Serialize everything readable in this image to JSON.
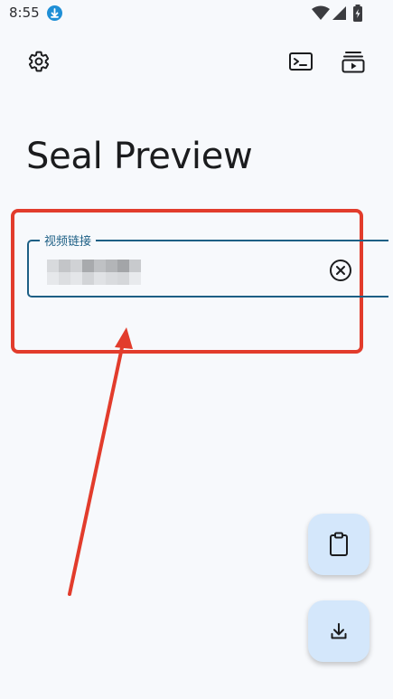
{
  "status_bar": {
    "time": "8:55",
    "icons": [
      "download-notification-icon",
      "wifi-icon",
      "signal-icon",
      "battery-charging-icon"
    ]
  },
  "toolbar": {
    "left_icon": "gear-icon",
    "right_icons": [
      "terminal-icon",
      "playlist-play-icon"
    ]
  },
  "page": {
    "title": "Seal Preview"
  },
  "url_input": {
    "label": "视频链接",
    "value_obscured": true,
    "trailing_icon": "clear-circle-icon"
  },
  "annotation": {
    "highlight_color": "#e23c2c",
    "arrow_color": "#e23c2c"
  },
  "fabs": [
    {
      "icon": "clipboard-icon"
    },
    {
      "icon": "download-icon"
    }
  ],
  "colors": {
    "background": "#f7f9fc",
    "field_outline": "#1d5f85",
    "fab_background": "#d4e7fb"
  }
}
